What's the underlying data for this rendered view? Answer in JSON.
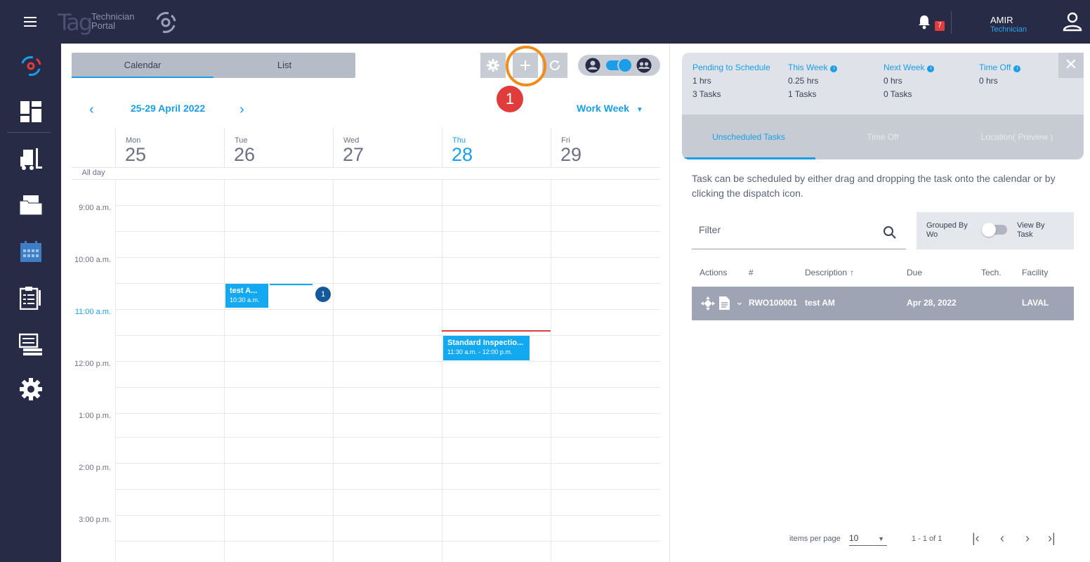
{
  "app": {
    "logo_text": "Tag",
    "logo_sub_1": "Technician",
    "logo_sub_2": "Portal"
  },
  "header": {
    "notification_count": "7",
    "user_name": "AMIR",
    "user_role": "Technician"
  },
  "sidebar": {
    "items": [
      "logo-swirl",
      "dashboard",
      "forklift",
      "documents",
      "calendar",
      "checklist",
      "receipts",
      "settings"
    ]
  },
  "calendar": {
    "view_tabs": [
      "Calendar",
      "List"
    ],
    "date_range": "25-29 April 2022",
    "view_mode": "Work Week",
    "days": [
      {
        "name": "Mon",
        "num": "25"
      },
      {
        "name": "Tue",
        "num": "26"
      },
      {
        "name": "Wed",
        "num": "27"
      },
      {
        "name": "Thu",
        "num": "28"
      },
      {
        "name": "Fri",
        "num": "29"
      }
    ],
    "all_day_label": "All day",
    "time_labels": [
      "9:00 a.m.",
      "10:00 a.m.",
      "11:00 a.m.",
      "12:00 p.m.",
      "1:00 p.m.",
      "2:00 p.m.",
      "3:00 p.m."
    ],
    "events": [
      {
        "title": "test A...",
        "time": "10:30 a.m."
      },
      {
        "title": "Standard Inspectio...",
        "time": "11:30 a.m. - 12:00 p.m."
      }
    ],
    "more_count": "1",
    "step_badge": "1"
  },
  "panel": {
    "summary": [
      {
        "label": "Pending to Schedule",
        "hours": "1 hrs",
        "tasks": "3 Tasks",
        "info": false
      },
      {
        "label": "This Week",
        "hours": "0.25 hrs",
        "tasks": "1 Tasks",
        "info": true
      },
      {
        "label": "Next Week",
        "hours": "0 hrs",
        "tasks": "0 Tasks",
        "info": true
      },
      {
        "label": "Time Off",
        "hours": "0 hrs",
        "tasks": "",
        "info": true
      }
    ],
    "tabs": [
      "Unscheduled Tasks",
      "Time Off",
      "Location( Preview )"
    ],
    "help_text": "Task can be scheduled by either drag and dropping the task onto the calendar or by clicking the dispatch icon.",
    "filter_placeholder": "Filter",
    "grouped_by_label": "Grouped By Wo",
    "view_by_label": "View By Task",
    "columns": [
      "Actions",
      "#",
      "Description",
      "Due",
      "Tech.",
      "Facility"
    ],
    "row": {
      "number": "RWO100001",
      "description": "test AM",
      "due": "Apr 28, 2022",
      "tech": "",
      "facility": "LAVAL"
    },
    "pager": {
      "items_per_page_label": "items per page",
      "items_per_page": "10",
      "range": "1 - 1 of 1"
    }
  },
  "colors": {
    "nav": "#272b45",
    "accent": "#1a9ee8",
    "event": "#12a9f1",
    "highlight": "#f08c1e",
    "badge": "#e03c3c"
  }
}
